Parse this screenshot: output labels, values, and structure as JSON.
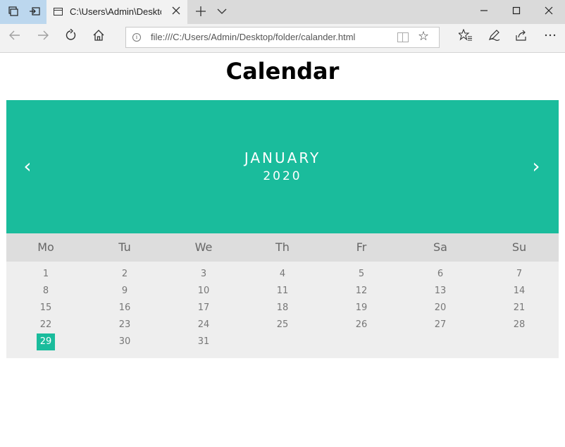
{
  "browser": {
    "tab_title": "C:\\Users\\Admin\\Deskto",
    "address": "file:///C:/Users/Admin/Desktop/folder/calander.html",
    "icons": {
      "tab_actions": "tab-actions-icon",
      "set_aside": "set-aside-tabs-icon",
      "page": "page-icon",
      "close_tab": "close-icon",
      "new_tab": "plus-icon",
      "tab_preview": "chevron-down-icon",
      "minimize": "minimize-icon",
      "maximize": "maximize-icon",
      "close_window": "close-icon",
      "back": "back-arrow-icon",
      "forward": "forward-arrow-icon",
      "refresh": "refresh-icon",
      "home": "home-icon",
      "info": "info-icon",
      "reading_view": "reading-view-icon",
      "favorite": "star-icon",
      "favorites_list": "favorites-list-icon",
      "web_note": "pen-icon",
      "share": "share-icon",
      "more": "more-icon"
    }
  },
  "page": {
    "title": "Calendar"
  },
  "calendar": {
    "month": "JANUARY",
    "year": "2020",
    "prev": "‹",
    "next": "›",
    "weekdays": [
      "Mo",
      "Tu",
      "We",
      "Th",
      "Fr",
      "Sa",
      "Su"
    ],
    "days": [
      "1",
      "2",
      "3",
      "4",
      "5",
      "6",
      "7",
      "8",
      "9",
      "10",
      "11",
      "12",
      "13",
      "14",
      "15",
      "16",
      "17",
      "18",
      "19",
      "20",
      "21",
      "22",
      "23",
      "24",
      "25",
      "26",
      "27",
      "28",
      "29",
      "30",
      "31"
    ],
    "active_day": "29",
    "accent_color": "#1abc9c",
    "weekday_bg": "#dddddd",
    "days_bg": "#eeeeee"
  }
}
